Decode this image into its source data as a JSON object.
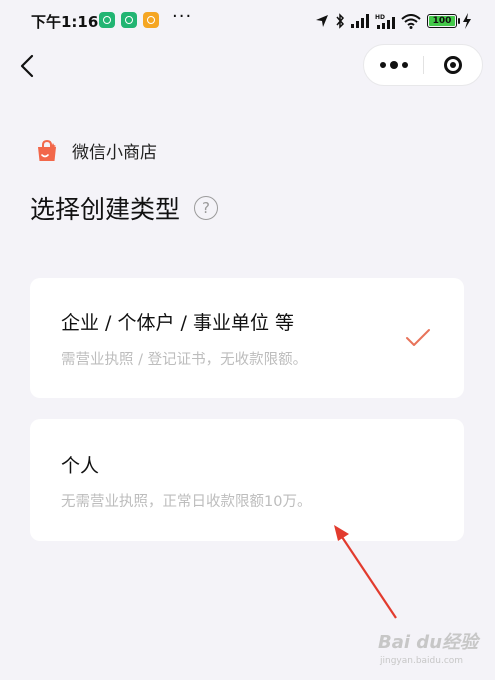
{
  "status_bar": {
    "time": "下午1:16",
    "more": "···",
    "battery": "100",
    "icons": [
      "green-app-icon",
      "green-app-icon",
      "orange-app-icon",
      "location-icon",
      "bluetooth-icon",
      "signal-icon",
      "hd-signal-icon",
      "wifi-icon",
      "battery-icon",
      "charging-icon"
    ]
  },
  "nav": {
    "back_icon": "chevron-left-icon",
    "menu_icon": "more-dots-icon",
    "close_icon": "target-icon"
  },
  "brand": {
    "name": "微信小商店",
    "logo": "shop-bag-icon",
    "color": "#f2674a"
  },
  "page": {
    "title": "选择创建类型",
    "help": "?"
  },
  "options": [
    {
      "title": "企业 / 个体户 / 事业单位 等",
      "description": "需营业执照 / 登记证书，无收款限额。",
      "selected": true
    },
    {
      "title": "个人",
      "description": "无需营业执照，正常日收款限额10万。",
      "selected": false
    }
  ],
  "colors": {
    "background": "#f4f3f8",
    "card": "#ffffff",
    "check": "#e8735a",
    "annotation": "#e23b2e",
    "muted_text": "#bdbdbd"
  },
  "watermark": {
    "main": "Bai du经验",
    "sub": "jingyan.baidu.com"
  }
}
